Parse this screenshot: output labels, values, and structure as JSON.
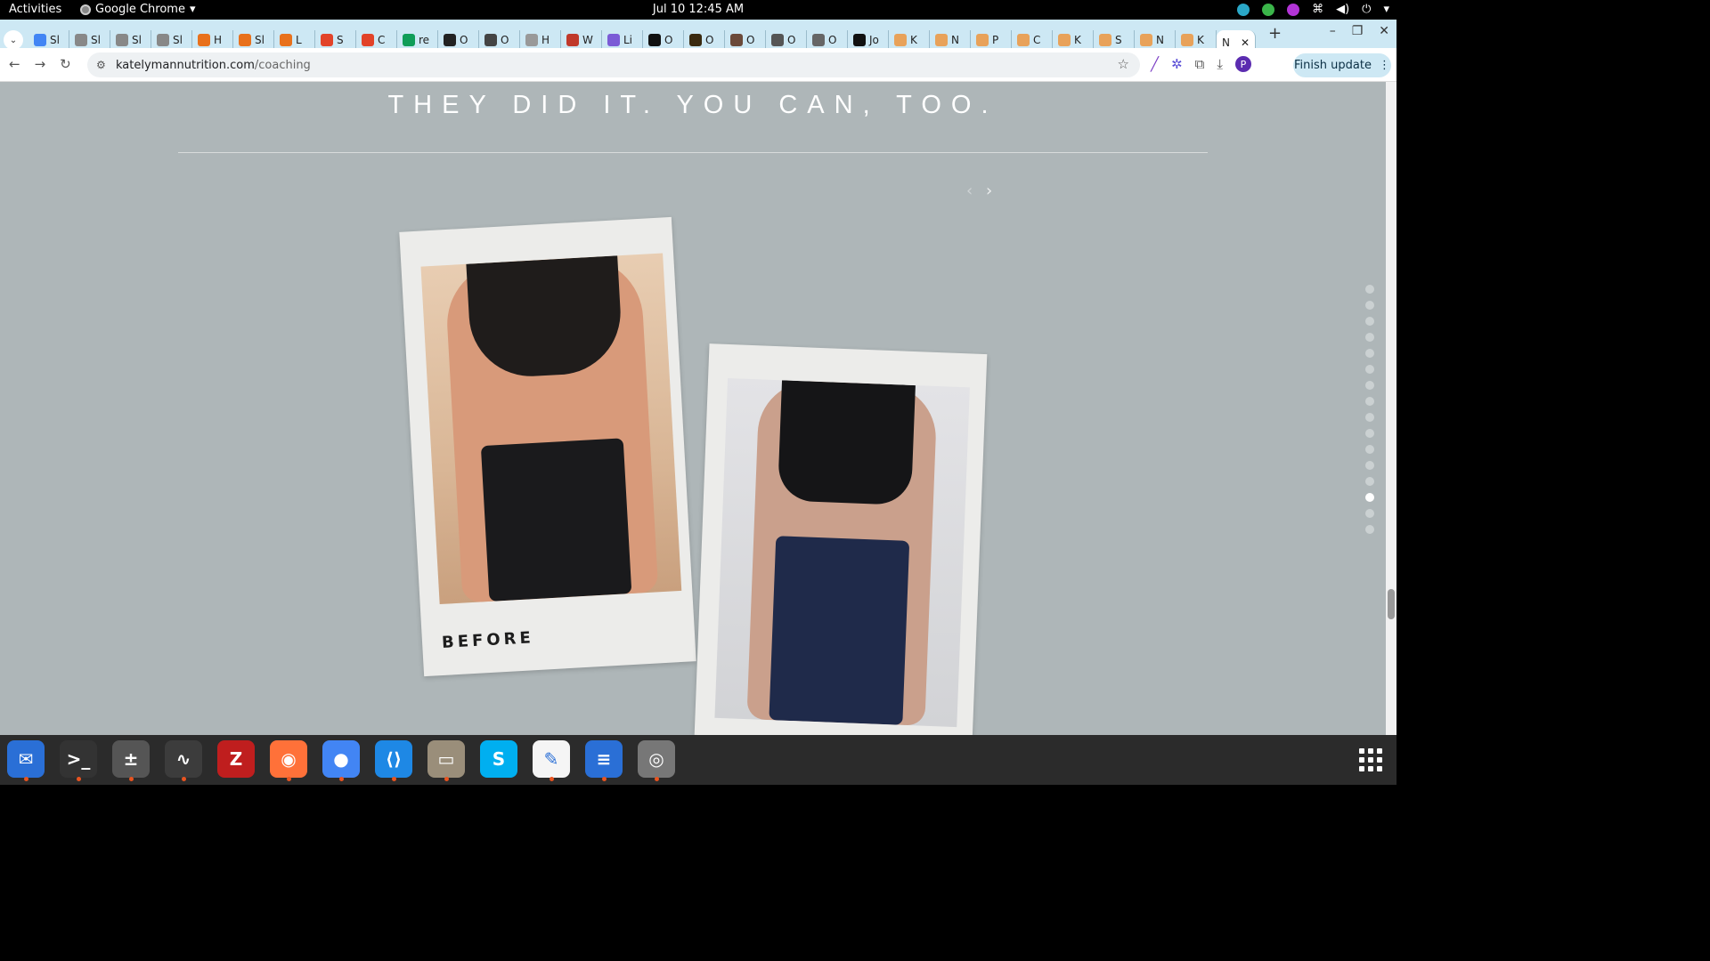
{
  "system": {
    "activities": "Activities",
    "app_menu": "Google Chrome",
    "clock": "Jul 10  12:45 AM"
  },
  "tabs": [
    {
      "label": "Sl",
      "color": "#4285f4"
    },
    {
      "label": "Sl",
      "color": "#888888"
    },
    {
      "label": "Sl",
      "color": "#888888"
    },
    {
      "label": "Sl",
      "color": "#888888"
    },
    {
      "label": "H",
      "color": "#e8711c"
    },
    {
      "label": "Sl",
      "color": "#e8711c"
    },
    {
      "label": "L",
      "color": "#e8711c"
    },
    {
      "label": "S",
      "color": "#e24329"
    },
    {
      "label": "C",
      "color": "#e24329"
    },
    {
      "label": "re",
      "color": "#0f9d58"
    },
    {
      "label": "O",
      "color": "#222222"
    },
    {
      "label": "O",
      "color": "#444444"
    },
    {
      "label": "H",
      "color": "#999999"
    },
    {
      "label": "W",
      "color": "#c0392b"
    },
    {
      "label": "Li",
      "color": "#7b5bd6"
    },
    {
      "label": "O",
      "color": "#111111"
    },
    {
      "label": "O",
      "color": "#3a2a10"
    },
    {
      "label": "O",
      "color": "#6b4a3a"
    },
    {
      "label": "O",
      "color": "#555555"
    },
    {
      "label": "O",
      "color": "#666666"
    },
    {
      "label": "Jo",
      "color": "#111111"
    },
    {
      "label": "K",
      "color": "#e8a25a"
    },
    {
      "label": "N",
      "color": "#e8a25a"
    },
    {
      "label": "P",
      "color": "#e8a25a"
    },
    {
      "label": "C",
      "color": "#e8a25a"
    },
    {
      "label": "K",
      "color": "#e8a25a"
    },
    {
      "label": "S",
      "color": "#e8a25a"
    },
    {
      "label": "N",
      "color": "#e8a25a"
    },
    {
      "label": "K",
      "color": "#e8a25a"
    }
  ],
  "active_tab": {
    "label": "N",
    "close": "✕"
  },
  "browser": {
    "url_domain": "katelymannutrition.com",
    "url_path": "/coaching",
    "finish_update": "Finish update",
    "profile_initial": "P"
  },
  "page": {
    "heading": "THEY DID IT. YOU CAN, TOO.",
    "prev_arrow": "‹",
    "next_arrow": "›",
    "before_caption": "BEFORE",
    "active_dot_index": 13,
    "dot_count": 16
  },
  "dock": {
    "apps": [
      {
        "name": "thunderbird",
        "glyph": "✉",
        "color": "#2a6fd6",
        "running": true
      },
      {
        "name": "terminal",
        "glyph": ">_",
        "color": "#333333",
        "running": true
      },
      {
        "name": "calculator",
        "glyph": "±",
        "color": "#555555",
        "running": true
      },
      {
        "name": "system-monitor",
        "glyph": "∿",
        "color": "#3c3c3c",
        "running": true
      },
      {
        "name": "filezilla",
        "glyph": "Z",
        "color": "#bf1e1e",
        "running": false
      },
      {
        "name": "firefox",
        "glyph": "◉",
        "color": "#ff7139",
        "running": true
      },
      {
        "name": "chrome",
        "glyph": "●",
        "color": "#4285f4",
        "running": true
      },
      {
        "name": "vscode",
        "glyph": "⟨⟩",
        "color": "#1e88e5",
        "running": true
      },
      {
        "name": "files",
        "glyph": "▭",
        "color": "#9a8e7a",
        "running": true
      },
      {
        "name": "skype",
        "glyph": "S",
        "color": "#00aff0",
        "running": false
      },
      {
        "name": "text-editor",
        "glyph": "✎",
        "color": "#f5f5f5",
        "running": true
      },
      {
        "name": "document-viewer",
        "glyph": "≡",
        "color": "#2a6fd6",
        "running": true
      },
      {
        "name": "disks",
        "glyph": "◎",
        "color": "#777777",
        "running": true
      }
    ]
  }
}
